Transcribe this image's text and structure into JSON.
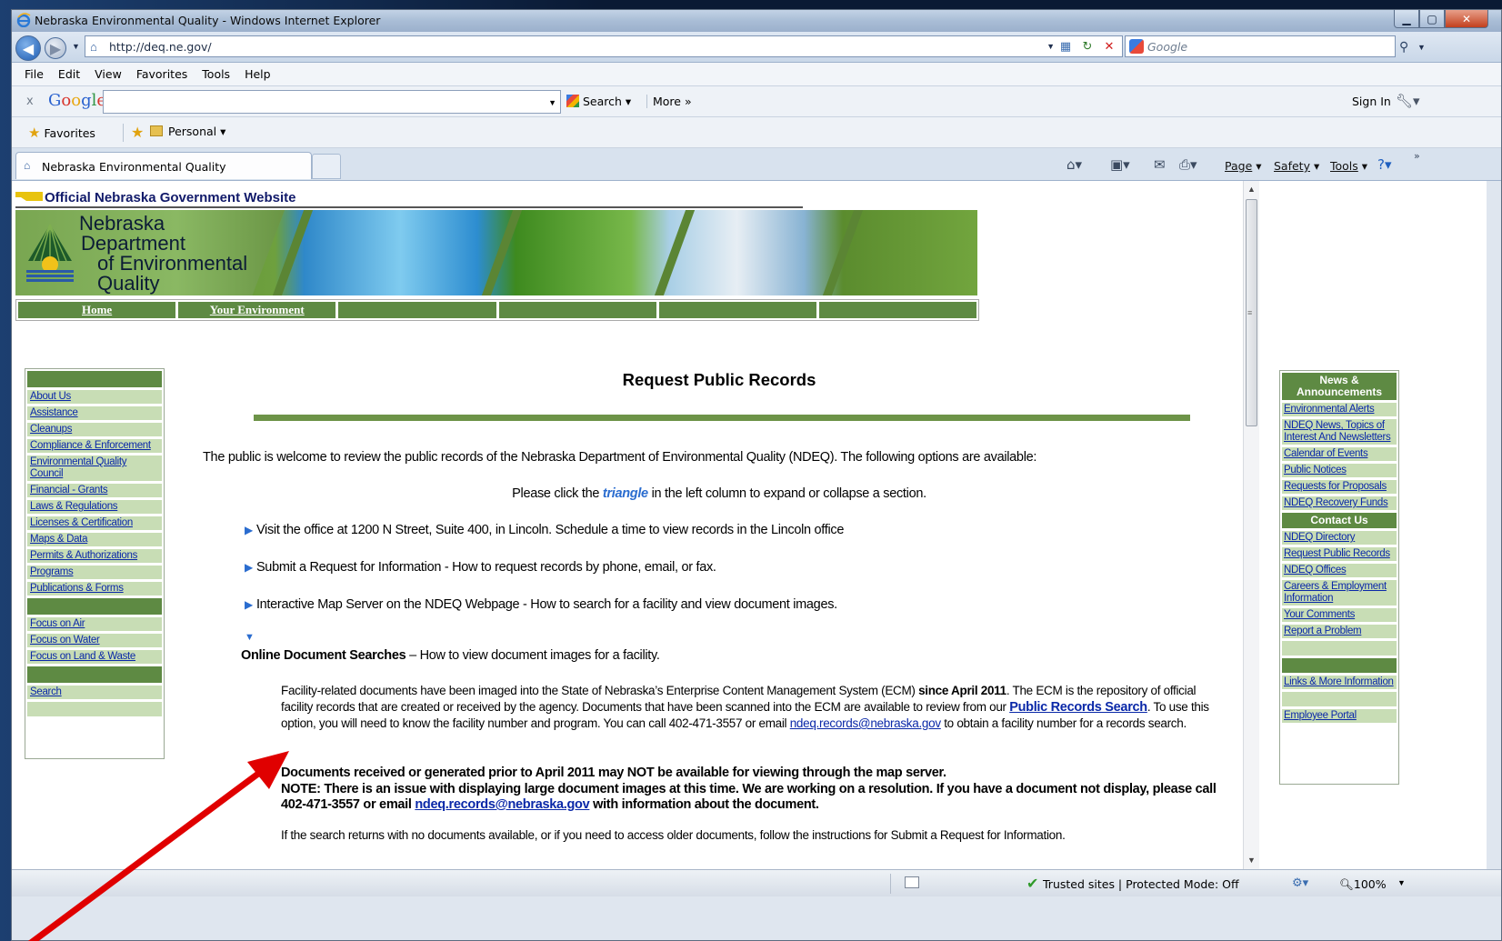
{
  "window": {
    "title": "Nebraska Environmental Quality - Windows Internet Explorer",
    "url": "http://deq.ne.gov/",
    "search_placeholder": "Google"
  },
  "menu": [
    "File",
    "Edit",
    "View",
    "Favorites",
    "Tools",
    "Help"
  ],
  "google_toolbar": {
    "close": "x",
    "logo": [
      "G",
      "o",
      "o",
      "g",
      "l",
      "e"
    ],
    "search_label": "Search",
    "more_label": "More »",
    "signin_label": "Sign In"
  },
  "favorites_bar": {
    "favorites_label": "Favorites",
    "personal_label": "Personal"
  },
  "tab": {
    "title": "Nebraska Environmental Quality"
  },
  "command_bar": {
    "page_label": "Page",
    "safety_label": "Safety",
    "tools_label": "Tools"
  },
  "page": {
    "official_banner": "Official Nebraska Government Website",
    "agency_name": [
      "Nebraska",
      "Department",
      "of Environmental",
      "Quality"
    ],
    "top_nav": [
      "Home",
      "Your Environment",
      "",
      "",
      "",
      ""
    ],
    "left_nav": {
      "group1": [
        "About Us",
        "Assistance",
        "Cleanups",
        "Compliance & Enforcement",
        "Environmental Quality Council",
        "Financial - Grants",
        "Laws & Regulations",
        "Licenses & Certification",
        "Maps & Data",
        "Permits & Authorizations",
        "Programs",
        "Publications & Forms"
      ],
      "group2": [
        "Focus on Air",
        "Focus on Water",
        "Focus on Land & Waste"
      ],
      "group3": [
        "Search"
      ]
    },
    "right_nav": {
      "news_header": "News & Announcements",
      "news": [
        "Environmental Alerts",
        "NDEQ News, Topics of Interest And Newsletters",
        "Calendar of Events",
        "Public Notices",
        "Requests for Proposals",
        "NDEQ Recovery Funds"
      ],
      "contact_header": "Contact Us",
      "contact": [
        "NDEQ Directory",
        "Request Public Records",
        "NDEQ Offices",
        "Careers & Employment Information",
        "Your Comments",
        "Report a Problem"
      ],
      "links": [
        "Links & More Information"
      ],
      "portal": [
        "Employee Portal"
      ]
    },
    "title": "Request Public Records",
    "intro": "The public is welcome to review the public records of the Nebraska Department of Environmental Quality (NDEQ). The following options are available:",
    "instruction_pre": "Please click the",
    "instruction_word": "triangle",
    "instruction_post": "in the left column to expand or collapse a section.",
    "options": [
      "Visit the office at 1200 N Street, Suite 400, in Lincoln. Schedule a time to view records in the Lincoln office",
      "Submit a Request for Information - How to request records by phone, email, or fax.",
      "Interactive Map Server on the NDEQ Webpage - How to search for a facility and view document images."
    ],
    "online": {
      "heading": "Online Document Searches",
      "heading_rest": " – How to view document images for a facility.",
      "p1_a": "Facility-related documents have been imaged into the State of Nebraska’s Enterprise Content Management System (ECM) ",
      "p1_b": "since April 2011",
      "p1_c": ". The ECM is the repository of official facility records that are created or received by the agency. Documents that have been scanned into the ECM are available to review from our ",
      "p1_link": "Public Records Search",
      "p1_d": ". To use this option, you will need to know the facility number and program. You can call 402-471-3557 or email ",
      "p1_email": "ndeq.records@nebraska.gov",
      "p1_e": " to obtain a facility number for a records search.",
      "note_a": "Documents received or generated prior to April 2011 may NOT be available for viewing through the map server.",
      "note_b": "NOTE: There is an issue with displaying large document images at this time. We are working on a resolution. If you have a document not display, please call 402-471-3557 or email ",
      "note_email": "ndeq.records@nebraska.gov",
      "note_c": " with information about the document.",
      "last": "If the search returns with no documents available, or if you need to access older documents, follow the instructions for Submit a Request for Information."
    }
  },
  "status": {
    "zone": "Trusted sites | Protected Mode: Off",
    "zoom": "100%"
  },
  "colors": {
    "nav_green": "#5e8a43",
    "nav_light": "#c8ddb5",
    "link_blue": "#0a28a8",
    "annotation_arrow": "#e00000"
  }
}
